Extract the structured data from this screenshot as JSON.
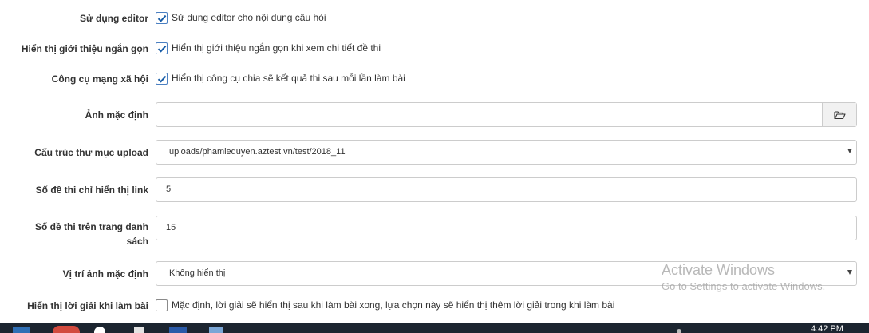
{
  "form": {
    "editor": {
      "label": "Sử dụng editor",
      "checked": true,
      "text": "Sử dụng editor cho nội dung câu hỏi"
    },
    "intro": {
      "label": "Hiển thị giới thiệu ngắn gọn",
      "checked": true,
      "text": "Hiển thị giới thiệu ngắn gọn khi xem chi tiết đề thi"
    },
    "social": {
      "label": "Công cụ mạng xã hội",
      "checked": true,
      "text": "Hiển thị công cụ chia sẽ kết quả thi sau mỗi lần làm bài"
    },
    "default_image": {
      "label": "Ảnh mặc định",
      "value": ""
    },
    "upload_dir": {
      "label": "Cấu trúc thư mục upload",
      "value": "uploads/phamlequyen.aztest.vn/test/2018_11"
    },
    "link_count": {
      "label": "Số đề thi chỉ hiển thị link",
      "value": "5"
    },
    "list_count": {
      "label_line1": "Số đề thi trên trang danh",
      "label_line2": "sách",
      "value": "15"
    },
    "image_position": {
      "label": "Vị trí ảnh mặc định",
      "value": "Không hiển thị"
    },
    "solution": {
      "label": "Hiển thị lời giải khi làm bài",
      "checked": false,
      "text": "Mặc định, lời giải sẽ hiển thị sau khi làm bài xong, lựa chọn này sẽ hiển thị thêm lời giải trong khi làm bài"
    }
  },
  "watermark": {
    "title": "Activate Windows",
    "subtitle": "Go to Settings to activate Windows."
  },
  "taskbar": {
    "clock": "4:42 PM"
  },
  "icons": {
    "check": "checkmark-icon",
    "folder": "folder-open-icon",
    "dropdown": "caret-down-icon"
  },
  "colors": {
    "check_accent": "#1a5ea8",
    "border": "#cccccc",
    "taskbar": "#1c2530"
  }
}
